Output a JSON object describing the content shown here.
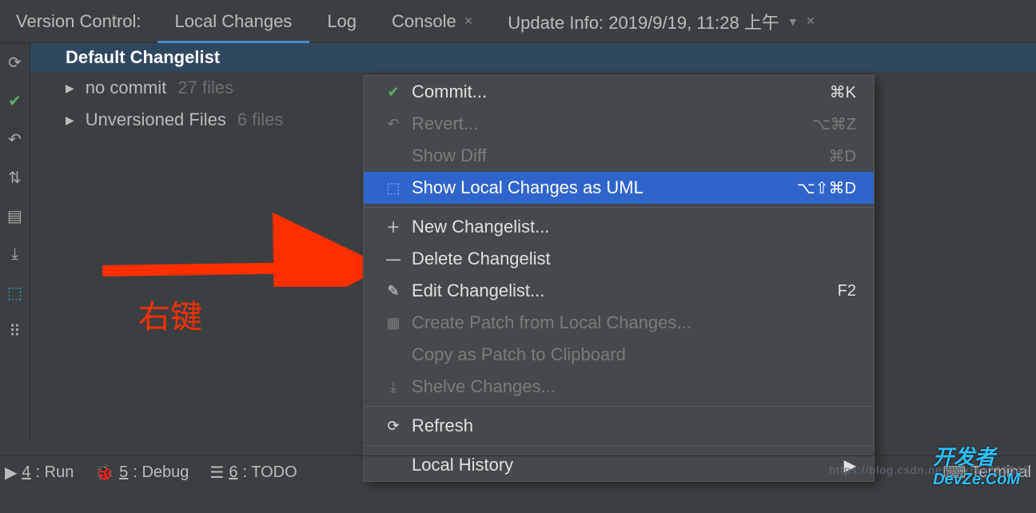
{
  "tabbar": {
    "title": "Version Control:",
    "tabs": [
      {
        "label": "Local Changes",
        "active": true,
        "closable": false
      },
      {
        "label": "Log",
        "active": false,
        "closable": false
      },
      {
        "label": "Console",
        "active": false,
        "closable": true
      },
      {
        "label": "Update Info: 2019/9/19, 11:28 上午",
        "active": false,
        "closable": true,
        "dropdown": true
      }
    ]
  },
  "tree": {
    "header": "Default Changelist",
    "nodes": [
      {
        "label": "no commit",
        "count": "27 files"
      },
      {
        "label": "Unversioned Files",
        "count": "6 files"
      }
    ]
  },
  "annotation": "右键",
  "menu": {
    "items": [
      {
        "icon": "check",
        "label": "Commit...",
        "shortcut": "⌘K"
      },
      {
        "icon": "undo",
        "label": "Revert...",
        "shortcut": "⌥⌘Z",
        "disabled": true
      },
      {
        "icon": "",
        "label": "Show Diff",
        "shortcut": "⌘D",
        "disabled": true
      },
      {
        "icon": "uml",
        "label": "Show Local Changes as UML",
        "shortcut": "⌥⇧⌘D",
        "highlight": true
      },
      {
        "sep": true
      },
      {
        "icon": "plus",
        "label": "New Changelist..."
      },
      {
        "icon": "minus",
        "label": "Delete Changelist"
      },
      {
        "icon": "pencil",
        "label": "Edit Changelist...",
        "shortcut": "F2"
      },
      {
        "icon": "patch",
        "label": "Create Patch from Local Changes...",
        "disabled": true
      },
      {
        "icon": "",
        "label": "Copy as Patch to Clipboard",
        "disabled": true
      },
      {
        "icon": "shelve",
        "label": "Shelve Changes...",
        "disabled": true
      },
      {
        "sep": true
      },
      {
        "icon": "refresh",
        "label": "Refresh"
      },
      {
        "sep": true
      },
      {
        "icon": "",
        "label": "Local History",
        "submenu": true
      }
    ]
  },
  "bottombar": {
    "items": [
      {
        "icon": "▶",
        "num": "4",
        "label": ": Run"
      },
      {
        "icon": "bug",
        "num": "5",
        "label": ": Debug"
      },
      {
        "icon": "list",
        "num": "6",
        "label": ": TODO"
      }
    ],
    "terminal": "Terminal"
  },
  "watermark": "https://blog.csdn.net/liuxiao723846",
  "logo": {
    "l1": "开发者",
    "l2": "DevZe.CoM"
  }
}
